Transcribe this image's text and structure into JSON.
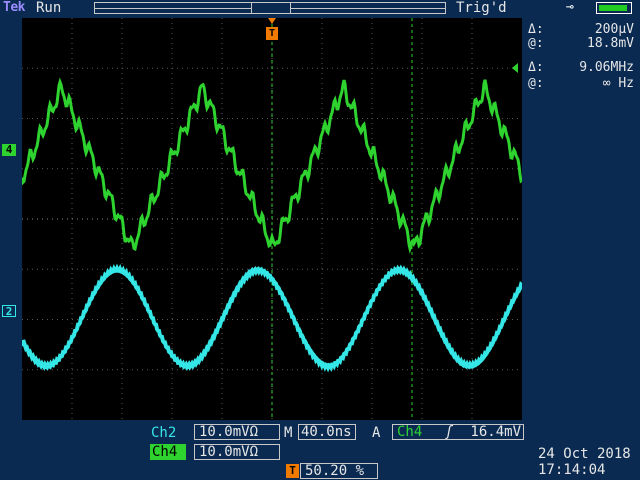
{
  "header": {
    "brand": "Tek",
    "run_state": "Run",
    "trigger_state": "Trig'd"
  },
  "icons": {
    "trigger_marker": "T",
    "trigger_position_marker": "T",
    "plug": "plug-icon",
    "battery": "battery-icon"
  },
  "channels": {
    "ch4_marker": "4",
    "ch2_marker": "2",
    "ch4_color": "#2fd32f",
    "ch2_color": "#35e6e6"
  },
  "cursor_readout": {
    "v_delta_label": "Δ:",
    "v_delta_value": "200µV",
    "v_at_label": "@:",
    "v_at_value": "18.8mV",
    "f_delta_label": "Δ:",
    "f_delta_value": "9.06MHz",
    "f_at_label": "@:",
    "f_at_value": "∞ Hz"
  },
  "bottom_bar": {
    "ch2_label": "Ch2",
    "ch2_scale": "10.0mVΩ",
    "horizontal_label": "M",
    "horizontal_scale": "40.0ns",
    "acq_mode": "A",
    "trigger_channel": "Ch4",
    "trigger_slope": "ʃ",
    "trigger_level": "16.4mV",
    "ch4_label": "Ch4",
    "ch4_scale": "10.0mVΩ",
    "trigger_position": "50.20 %",
    "date": "24 Oct  2018",
    "time": "17:14:04"
  }
}
